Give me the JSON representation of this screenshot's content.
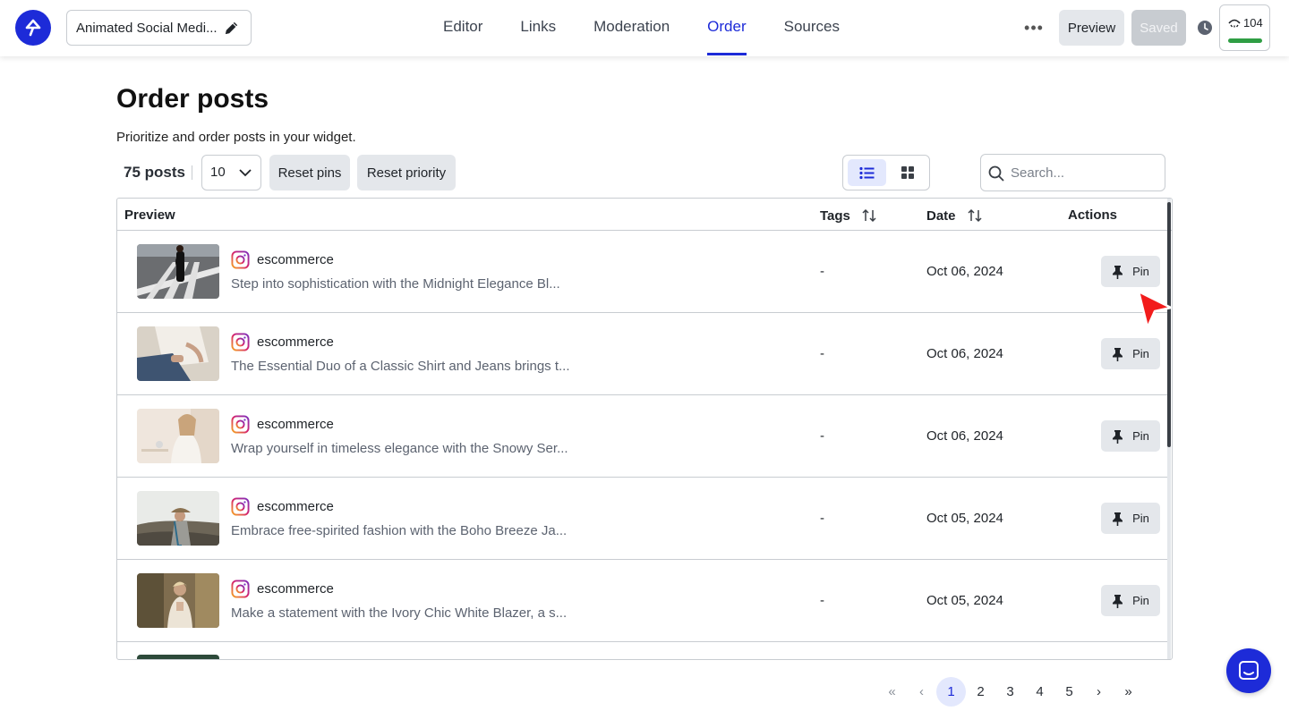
{
  "header": {
    "project_title": "Animated Social Medi...",
    "tabs": [
      {
        "label": "Editor",
        "active": false
      },
      {
        "label": "Links",
        "active": false
      },
      {
        "label": "Moderation",
        "active": false
      },
      {
        "label": "Order",
        "active": true
      },
      {
        "label": "Sources",
        "active": false
      }
    ],
    "more_label": "•••",
    "preview_label": "Preview",
    "saved_label": "Saved",
    "views_count": "104",
    "accent_color": "#1d2bd8"
  },
  "page": {
    "title": "Order posts",
    "subtitle": "Prioritize and order posts in your widget.",
    "post_count": "75 posts",
    "per_page": "10",
    "reset_pins_label": "Reset pins",
    "reset_priority_label": "Reset priority",
    "view_mode": "list",
    "search_placeholder": "Search..."
  },
  "table": {
    "columns": [
      "Preview",
      "Tags",
      "Date",
      "Actions"
    ],
    "rows": [
      {
        "author": "escommerce",
        "caption": "Step into sophistication with the Midnight Elegance Bl...",
        "tags": "-",
        "date": "Oct 06, 2024",
        "action": "Pin"
      },
      {
        "author": "escommerce",
        "caption": "The Essential Duo of a Classic Shirt and Jeans brings t...",
        "tags": "-",
        "date": "Oct 06, 2024",
        "action": "Pin"
      },
      {
        "author": "escommerce",
        "caption": "Wrap yourself in timeless elegance with the Snowy Ser...",
        "tags": "-",
        "date": "Oct 06, 2024",
        "action": "Pin"
      },
      {
        "author": "escommerce",
        "caption": "Embrace free-spirited fashion with the Boho Breeze Ja...",
        "tags": "-",
        "date": "Oct 05, 2024",
        "action": "Pin"
      },
      {
        "author": "escommerce",
        "caption": "Make a statement with the Ivory Chic White Blazer, a s...",
        "tags": "-",
        "date": "Oct 05, 2024",
        "action": "Pin"
      }
    ]
  },
  "pagination": {
    "first": "«",
    "prev": "‹",
    "pages": [
      "1",
      "2",
      "3",
      "4",
      "5"
    ],
    "current": "1",
    "next": "›",
    "last": "»"
  }
}
